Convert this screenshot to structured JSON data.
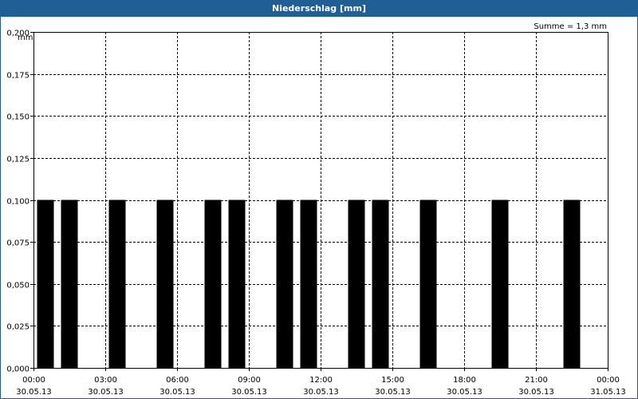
{
  "window": {
    "title": "Niederschlag [mm]"
  },
  "summary": {
    "text": "Summe = 1,3 mm"
  },
  "chart_data": {
    "type": "bar",
    "title": "Niederschlag [mm]",
    "ylabel": "mm",
    "xlabel": "",
    "ylim": [
      0,
      0.2
    ],
    "y_ticks": [
      {
        "value": 0.0,
        "label": "0,000"
      },
      {
        "value": 0.025,
        "label": "0,025"
      },
      {
        "value": 0.05,
        "label": "0,050"
      },
      {
        "value": 0.075,
        "label": "0,075"
      },
      {
        "value": 0.1,
        "label": "0,100"
      },
      {
        "value": 0.125,
        "label": "0,125"
      },
      {
        "value": 0.15,
        "label": "0,150"
      },
      {
        "value": 0.175,
        "label": "0,175"
      },
      {
        "value": 0.2,
        "label": "0,200"
      }
    ],
    "x_range_hours": [
      0,
      24
    ],
    "x_ticks": [
      {
        "hour": 0,
        "time": "00:00",
        "date": "30.05.13"
      },
      {
        "hour": 3,
        "time": "03:00",
        "date": "30.05.13"
      },
      {
        "hour": 6,
        "time": "06:00",
        "date": "30.05.13"
      },
      {
        "hour": 9,
        "time": "09:00",
        "date": "30.05.13"
      },
      {
        "hour": 12,
        "time": "12:00",
        "date": "30.05.13"
      },
      {
        "hour": 15,
        "time": "15:00",
        "date": "30.05.13"
      },
      {
        "hour": 18,
        "time": "18:00",
        "date": "30.05.13"
      },
      {
        "hour": 21,
        "time": "21:00",
        "date": "30.05.13"
      },
      {
        "hour": 24,
        "time": "00:00",
        "date": "31.05.13"
      }
    ],
    "bars": [
      {
        "hour": 1.0,
        "value": 0.1
      },
      {
        "hour": 2.0,
        "value": 0.1
      },
      {
        "hour": 4.0,
        "value": 0.1
      },
      {
        "hour": 6.0,
        "value": 0.1
      },
      {
        "hour": 8.0,
        "value": 0.1
      },
      {
        "hour": 9.0,
        "value": 0.1
      },
      {
        "hour": 11.0,
        "value": 0.1
      },
      {
        "hour": 12.0,
        "value": 0.1
      },
      {
        "hour": 14.0,
        "value": 0.1
      },
      {
        "hour": 15.0,
        "value": 0.1
      },
      {
        "hour": 17.0,
        "value": 0.1
      },
      {
        "hour": 20.0,
        "value": 0.1
      },
      {
        "hour": 23.0,
        "value": 0.1
      }
    ],
    "grid": true,
    "bar_color": "#000000"
  }
}
